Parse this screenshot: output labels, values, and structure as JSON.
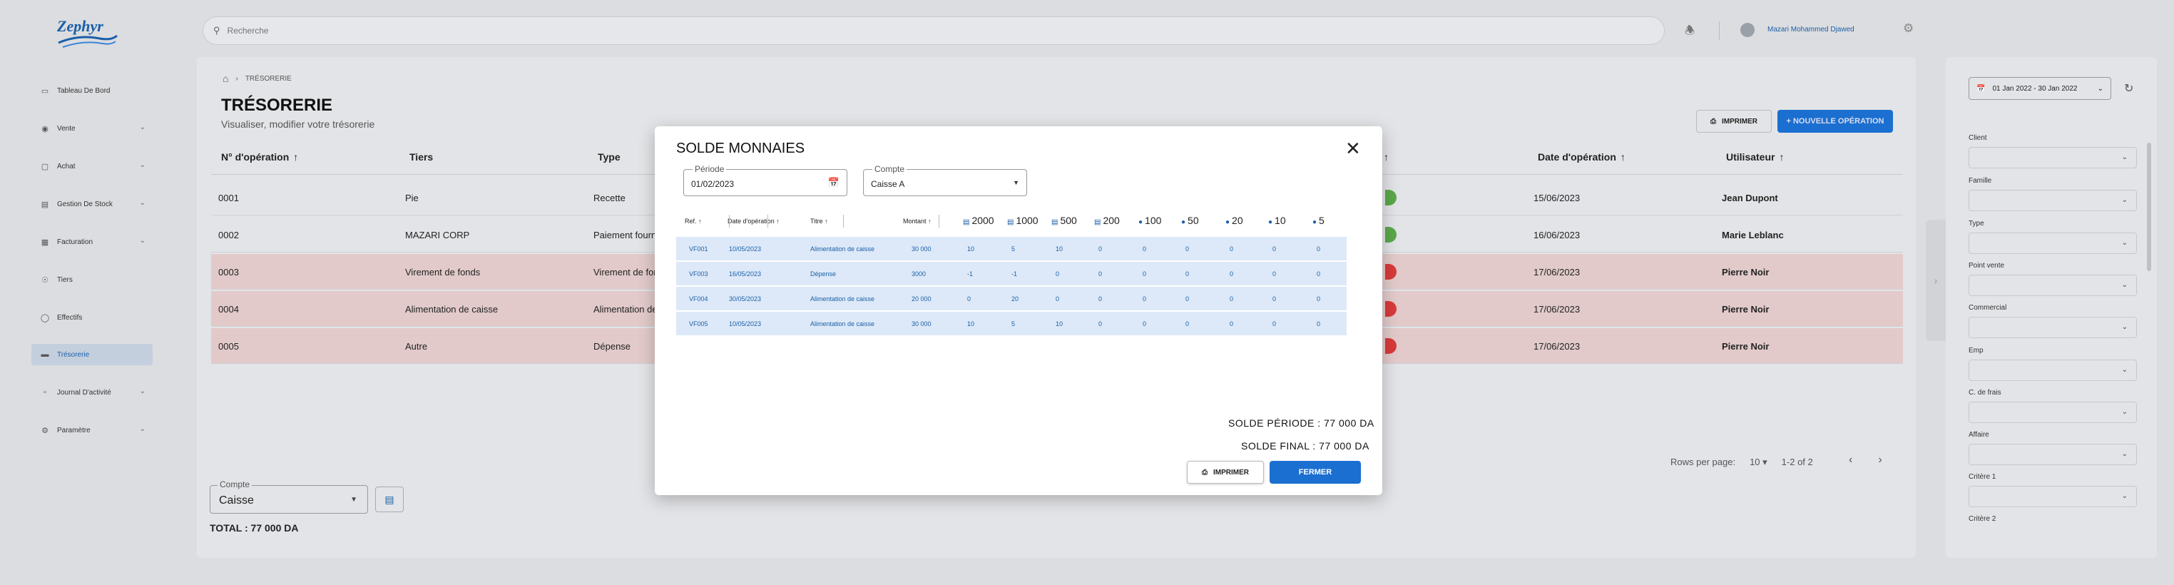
{
  "app": {
    "logo_text": "Zephyr"
  },
  "sidebar": {
    "items": [
      {
        "label": "Tableau De Bord",
        "icon": "monitor-icon",
        "chevron": false,
        "active": false
      },
      {
        "label": "Vente",
        "icon": "database-icon",
        "chevron": true,
        "active": false
      },
      {
        "label": "Achat",
        "icon": "bag-icon",
        "chevron": true,
        "active": false
      },
      {
        "label": "Gestion De Stock",
        "icon": "box-icon",
        "chevron": true,
        "active": false
      },
      {
        "label": "Facturation",
        "icon": "document-icon",
        "chevron": true,
        "active": false
      },
      {
        "label": "Tiers",
        "icon": "people-icon",
        "chevron": false,
        "active": false
      },
      {
        "label": "Effectifs",
        "icon": "user-icon",
        "chevron": false,
        "active": false
      },
      {
        "label": "Trésorerie",
        "icon": "wallet-icon",
        "chevron": false,
        "active": true
      },
      {
        "label": "Journal D'activité",
        "icon": "journal-icon",
        "chevron": true,
        "active": false
      },
      {
        "label": "Paramètre",
        "icon": "settings-icon",
        "chevron": true,
        "active": false
      }
    ]
  },
  "topbar": {
    "search_placeholder": "Recherche",
    "user_name": "Mazari Mohammed Djawed"
  },
  "page": {
    "breadcrumb": "TRÉSORERIE",
    "title": "TRÉSORERIE",
    "subtitle": "Visualiser, modifier votre trésorerie",
    "print_label": "IMPRIMER",
    "new_label": "+ NOUVELLE OPÉRATION"
  },
  "table": {
    "headers": {
      "num": "N° d'opération",
      "tiers": "Tiers",
      "type": "Type",
      "date": "Date d'opération",
      "user": "Utilisateur"
    },
    "rows": [
      {
        "num": "0001",
        "tiers": "Pie",
        "type": "Recette",
        "date": "15/06/2023",
        "user": "Jean Dupont",
        "red": false,
        "badge": "#5aa84a"
      },
      {
        "num": "0002",
        "tiers": "MAZARI CORP",
        "type": "Paiement fourn",
        "date": "16/06/2023",
        "user": "Marie Leblanc",
        "red": false,
        "badge": "#5aa84a"
      },
      {
        "num": "0003",
        "tiers": "Virement de fonds",
        "type": "Virement de for",
        "date": "17/06/2023",
        "user": "Pierre Noir",
        "red": true,
        "badge": "#d93a3a"
      },
      {
        "num": "0004",
        "tiers": "Alimentation de caisse",
        "type": "Alimentation de",
        "date": "17/06/2023",
        "user": "Pierre Noir",
        "red": true,
        "badge": "#d93a3a"
      },
      {
        "num": "0005",
        "tiers": "Autre",
        "type": "Dépense",
        "date": "17/06/2023",
        "user": "Pierre Noir",
        "red": true,
        "badge": "#d93a3a"
      }
    ],
    "rows_per_page_label": "Rows per page:",
    "rows_per_page": "10",
    "range": "1-2 of 2"
  },
  "footer": {
    "compte_label": "Compte",
    "compte_value": "Caisse",
    "total": "TOTAL : 77 000 DA"
  },
  "filters": {
    "date_range": "01 Jan 2022 - 30 Jan 2022",
    "fields": [
      "Client",
      "Famille",
      "Type",
      "Point vente",
      "Commercial",
      "Emp",
      "C. de frais",
      "Affaire",
      "Critère 1",
      "Critère 2"
    ]
  },
  "modal": {
    "title": "SOLDE MONNAIES",
    "periode_label": "Période",
    "periode_value": "01/02/2023",
    "compte_label": "Compte",
    "compte_value": "Caisse A",
    "headers": {
      "ref": "Ref.",
      "date": "Date d'opération",
      "titre": "Titre",
      "montant": "Montant"
    },
    "denominations": [
      "2000",
      "1000",
      "500",
      "200",
      "100",
      "50",
      "20",
      "10",
      "5"
    ],
    "rows": [
      {
        "ref": "VF001",
        "date": "10/05/2023",
        "titre": "Alimentation de caisse",
        "montant": "30 000",
        "counts": [
          "10",
          "5",
          "10",
          "0",
          "0",
          "0",
          "0",
          "0",
          "0"
        ]
      },
      {
        "ref": "VF003",
        "date": "16/05/2023",
        "titre": "Dépense",
        "montant": "3000",
        "counts": [
          "-1",
          "-1",
          "0",
          "0",
          "0",
          "0",
          "0",
          "0",
          "0"
        ]
      },
      {
        "ref": "VF004",
        "date": "30/05/2023",
        "titre": "Alimentation de caisse",
        "montant": "20 000",
        "counts": [
          "0",
          "20",
          "0",
          "0",
          "0",
          "0",
          "0",
          "0",
          "0"
        ]
      },
      {
        "ref": "VF005",
        "date": "10/05/2023",
        "titre": "Alimentation de caisse",
        "montant": "30 000",
        "counts": [
          "10",
          "5",
          "10",
          "0",
          "0",
          "0",
          "0",
          "0",
          "0"
        ]
      }
    ],
    "solde_periode": "SOLDE PÉRIODE : 77 000 DA",
    "solde_final": "SOLDE FINAL : 77 000 DA",
    "print_label": "IMPRIMER",
    "close_label": "FERMER"
  }
}
